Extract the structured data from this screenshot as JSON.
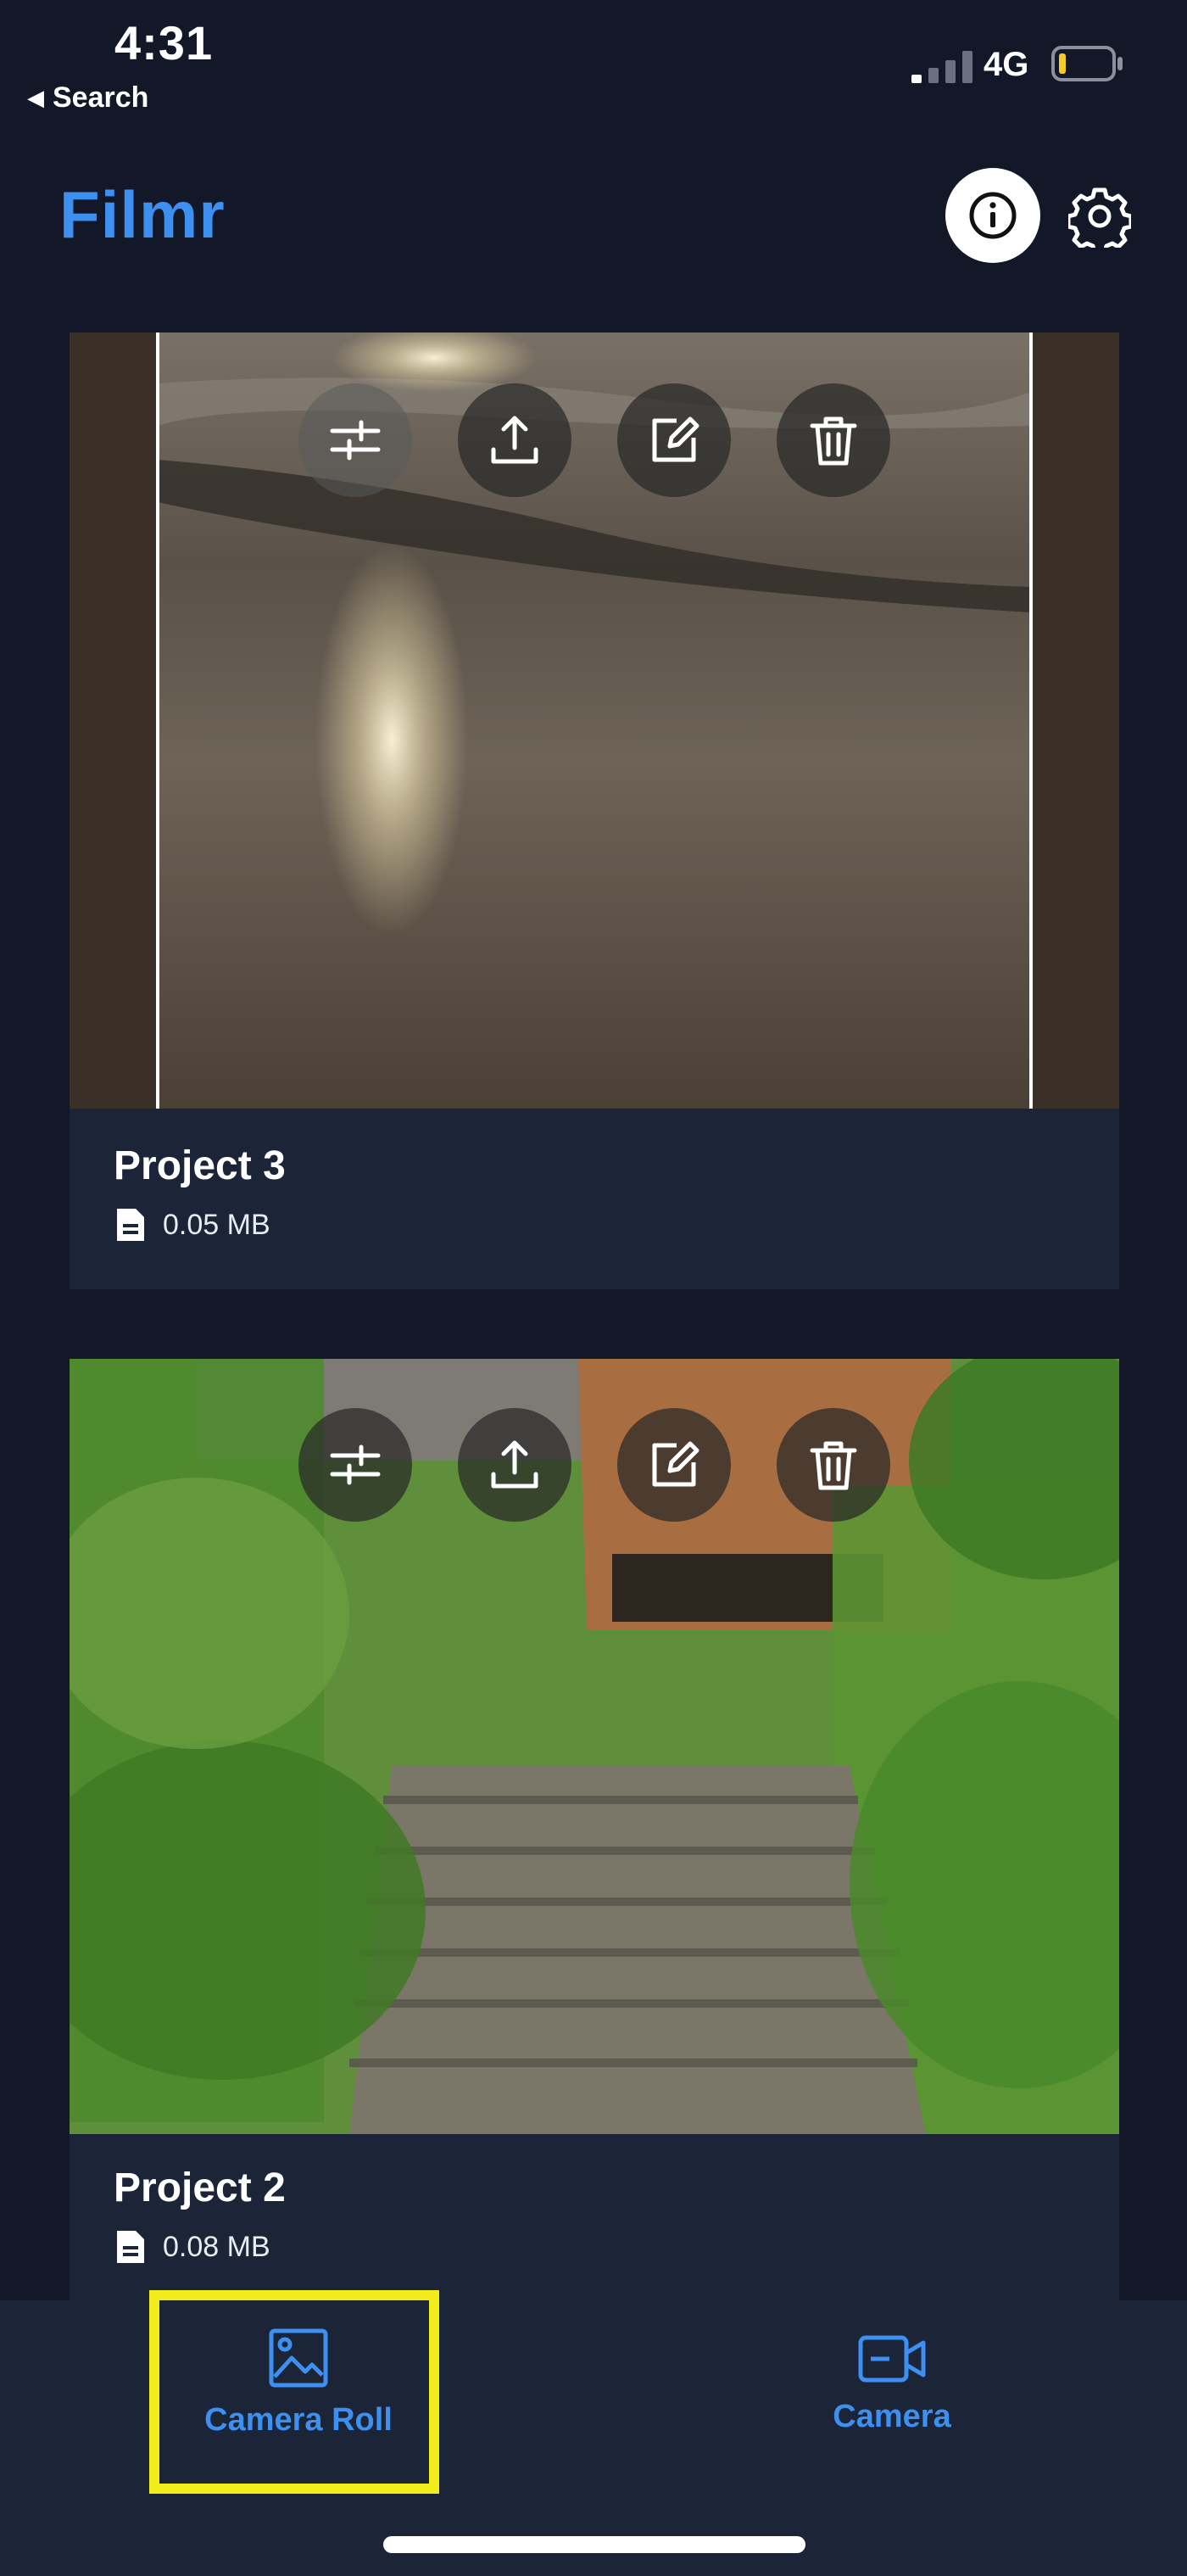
{
  "status_bar": {
    "time": "4:31",
    "back_label": "Search",
    "network": "4G",
    "battery_color": "#f3cb2a"
  },
  "header": {
    "title": "Filmr",
    "icons": [
      "info-icon",
      "gear-icon"
    ]
  },
  "projects": [
    {
      "title": "Project 3",
      "size": "0.05 MB"
    },
    {
      "title": "Project 2",
      "size": "0.08 MB"
    }
  ],
  "project_actions": [
    "adjust-icon",
    "share-icon",
    "edit-icon",
    "trash-icon"
  ],
  "tabs": [
    {
      "label": "Camera Roll",
      "icon": "image-icon"
    },
    {
      "label": "Camera",
      "icon": "video-camera-icon"
    }
  ],
  "colors": {
    "background": "#121828",
    "card": "#1c2438",
    "accent": "#3d8ff0",
    "highlight": "#f2ec1c"
  }
}
